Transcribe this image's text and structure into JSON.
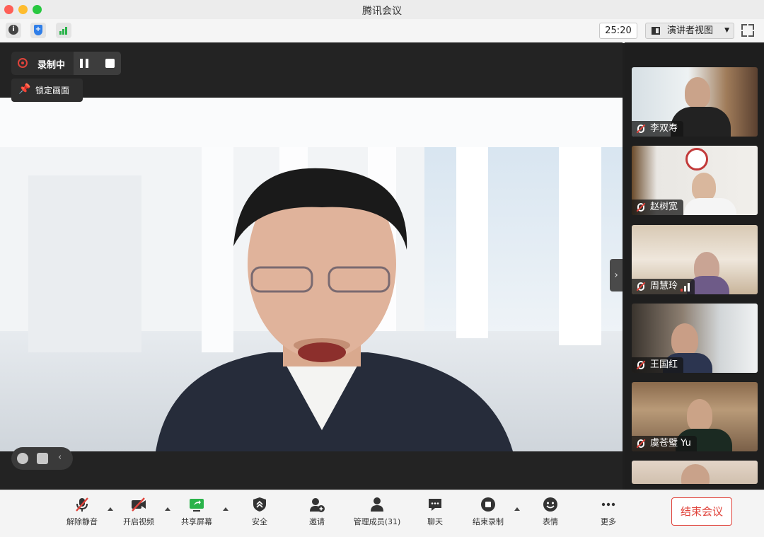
{
  "window": {
    "title": "腾讯会议"
  },
  "toolbar": {
    "timer": "25:20",
    "view_label": "演讲者视图",
    "info_icon": "info-icon",
    "security_icon": "shield-icon",
    "signal_icon": "signal-icon",
    "fullscreen_icon": "fullscreen-icon"
  },
  "recording": {
    "label": "录制中",
    "pause_icon": "pause-icon",
    "stop_icon": "stop-icon"
  },
  "pin": {
    "label": "锁定画面",
    "icon": "pin-icon"
  },
  "participants": [
    {
      "name": "李双寿",
      "muted": true
    },
    {
      "name": "赵树宽",
      "muted": true
    },
    {
      "name": "周慧玲",
      "muted": true
    },
    {
      "name": "王国红",
      "muted": true
    },
    {
      "name": "虞苍璧 Yu",
      "muted": true
    }
  ],
  "controls": [
    {
      "label": "解除静音",
      "icon": "mic-muted-icon"
    },
    {
      "label": "开启视频",
      "icon": "video-off-icon"
    },
    {
      "label": "共享屏幕",
      "icon": "share-screen-icon"
    },
    {
      "label": "安全",
      "icon": "security-icon"
    },
    {
      "label": "邀请",
      "icon": "invite-icon"
    },
    {
      "label": "管理成员(31)",
      "icon": "members-icon"
    },
    {
      "label": "聊天",
      "icon": "chat-icon"
    },
    {
      "label": "结束录制",
      "icon": "stop-record-icon"
    },
    {
      "label": "表情",
      "icon": "emoji-icon"
    },
    {
      "label": "更多",
      "icon": "more-icon"
    }
  ],
  "end_button": {
    "label": "结束会议"
  },
  "colors": {
    "accent_red": "#e0433b",
    "share_green": "#2ab34a",
    "security_blue": "#2f7ee8"
  }
}
